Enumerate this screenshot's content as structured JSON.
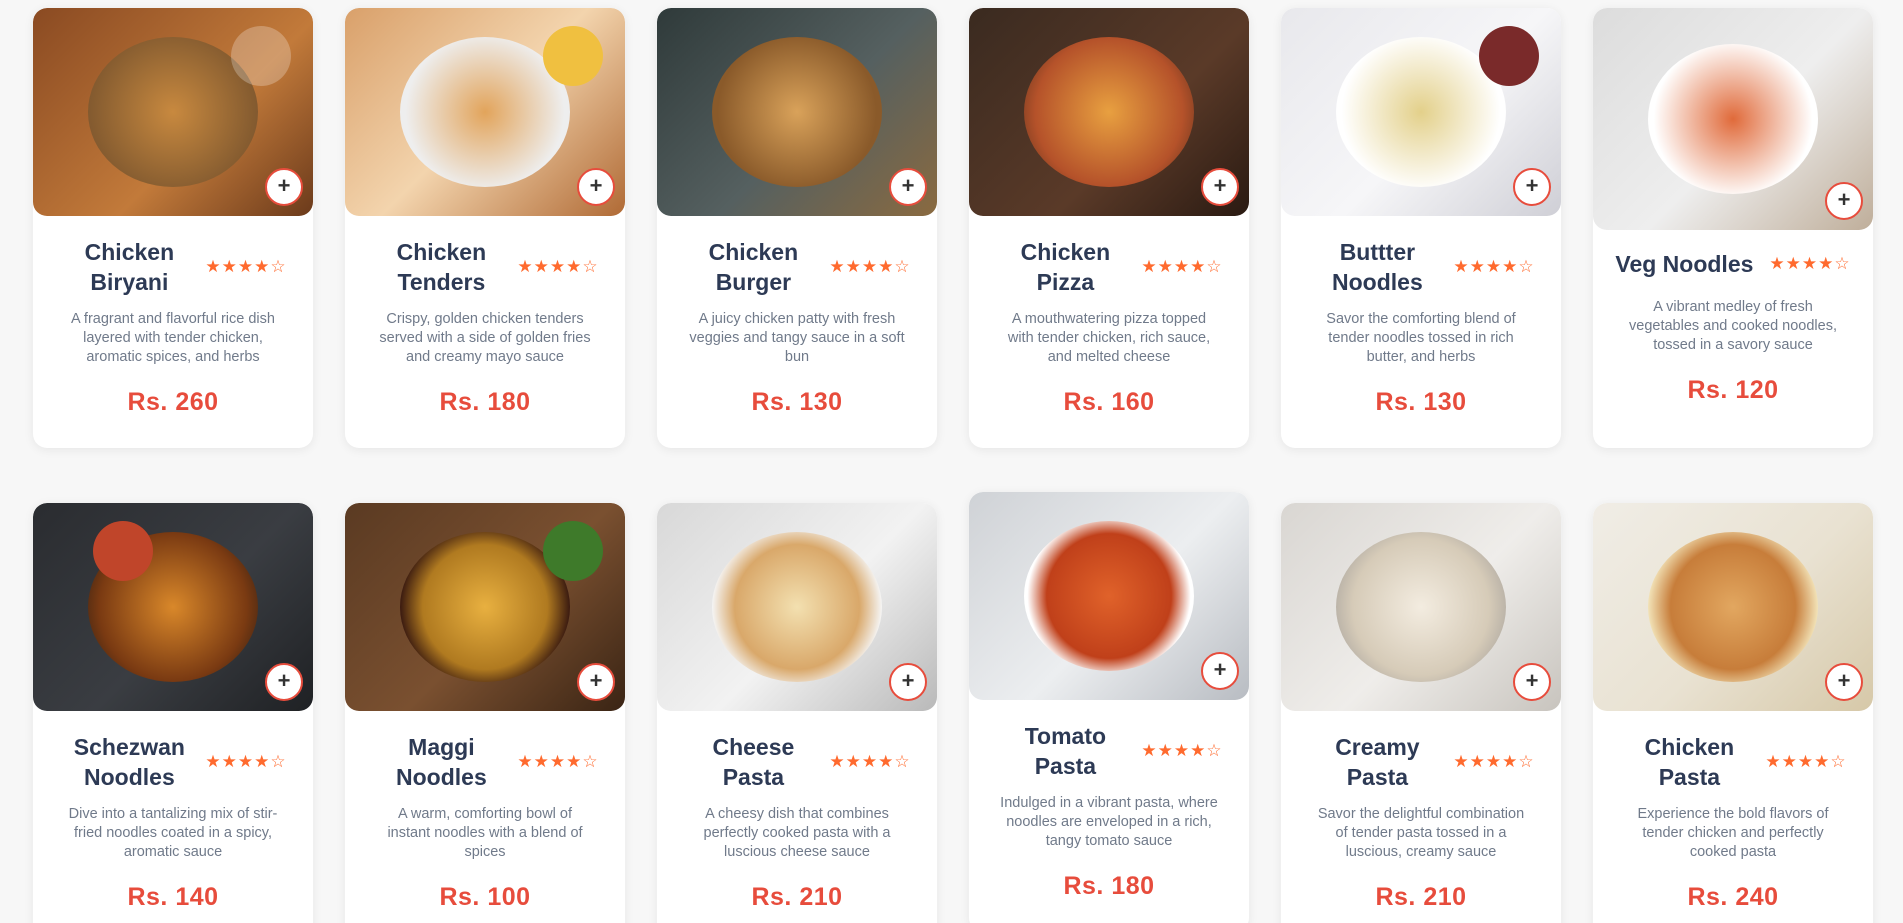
{
  "add_label": "+",
  "stars_label": "★★★★☆",
  "items": [
    {
      "name": "Chicken Biryani",
      "desc": "A fragrant and flavorful rice dish layered with tender chicken, aromatic spices, and herbs",
      "price": "Rs. 260"
    },
    {
      "name": "Chicken Tenders",
      "desc": "Crispy, golden chicken tenders served with a side of golden fries and creamy mayo sauce",
      "price": "Rs. 180"
    },
    {
      "name": "Chicken Burger",
      "desc": "A juicy chicken patty with fresh veggies and tangy sauce in a soft bun",
      "price": "Rs. 130"
    },
    {
      "name": "Chicken Pizza",
      "desc": "A mouthwatering pizza topped with tender chicken, rich sauce, and melted cheese",
      "price": "Rs. 160"
    },
    {
      "name": "Buttter Noodles",
      "desc": "Savor the comforting blend of tender noodles tossed in rich butter, and herbs",
      "price": "Rs. 130"
    },
    {
      "name": "Veg Noodles",
      "desc": "A vibrant medley of fresh vegetables and cooked noodles, tossed in a savory sauce",
      "price": "Rs. 120"
    },
    {
      "name": "Schezwan Noodles",
      "desc": "Dive into a tantalizing mix of stir-fried noodles coated in a spicy, aromatic sauce",
      "price": "Rs. 140"
    },
    {
      "name": "Maggi Noodles",
      "desc": "A warm, comforting bowl of instant noodles with a blend of spices",
      "price": "Rs. 100"
    },
    {
      "name": "Cheese Pasta",
      "desc": "A cheesy dish that combines perfectly cooked pasta with a luscious cheese sauce",
      "price": "Rs. 210"
    },
    {
      "name": "Tomato Pasta",
      "desc": "Indulged in a vibrant pasta, where noodles are enveloped in a rich, tangy tomato sauce",
      "price": "Rs. 180"
    },
    {
      "name": "Creamy Pasta",
      "desc": "Savor the delightful combination of tender pasta tossed in a luscious, creamy sauce",
      "price": "Rs. 210"
    },
    {
      "name": "Chicken Pasta",
      "desc": "Experience the bold flavors of tender chicken and perfectly cooked pasta",
      "price": "Rs. 240"
    }
  ],
  "colors": {
    "accent": "#e74c3c",
    "star": "#ff6a2e",
    "title": "#2d3a55",
    "text": "#707a8a"
  }
}
